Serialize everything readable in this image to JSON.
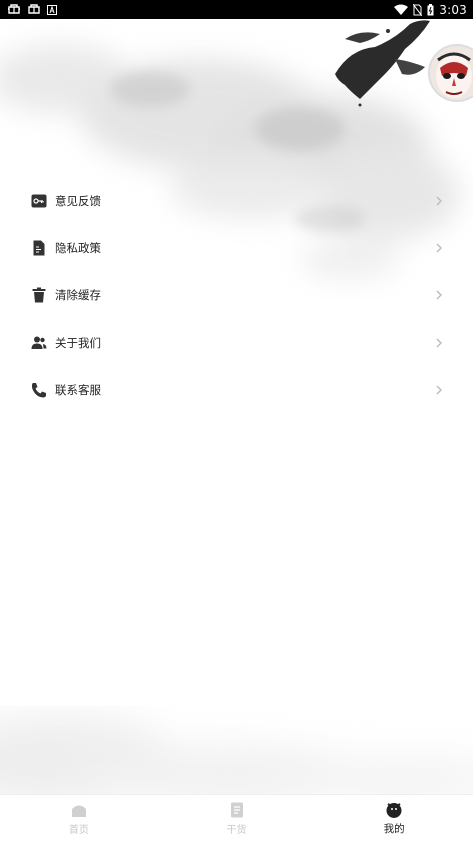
{
  "status_bar": {
    "time": "3:03",
    "left_icons": [
      "bug-icon",
      "bug-icon",
      "font-a-icon"
    ],
    "right_icons": [
      "wifi-icon",
      "no-sim-icon",
      "battery-icon"
    ]
  },
  "menu": {
    "items": [
      {
        "label": "意见反馈",
        "icon": "key-icon"
      },
      {
        "label": "隐私政策",
        "icon": "document-icon"
      },
      {
        "label": "清除缓存",
        "icon": "trash-icon"
      },
      {
        "label": "关于我们",
        "icon": "users-icon"
      },
      {
        "label": "联系客服",
        "icon": "phone-icon"
      }
    ]
  },
  "bottom_nav": {
    "tabs": [
      {
        "label": "首页",
        "icon": "home-icon",
        "active": false
      },
      {
        "label": "干货",
        "icon": "article-icon",
        "active": false
      },
      {
        "label": "我的",
        "icon": "profile-icon",
        "active": true
      }
    ]
  },
  "colors": {
    "status_bar_bg": "#000000",
    "text": "#222222",
    "inactive_nav": "#c8c8c8",
    "icon": "#333333",
    "chevron": "#bbbbbb"
  }
}
